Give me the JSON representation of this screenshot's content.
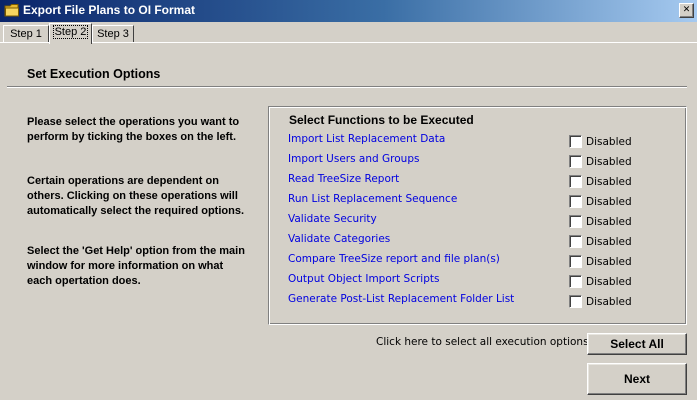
{
  "window": {
    "title": "Export File Plans to OI Format",
    "icon": "folder-icon",
    "close_glyph": "✕"
  },
  "tabs": [
    {
      "label": "Step 1",
      "active": false
    },
    {
      "label": "Step 2",
      "active": true
    },
    {
      "label": "Step 3",
      "active": false
    }
  ],
  "main": {
    "section_title": "Set Execution Options",
    "instructions": [
      "Please select the operations you want to perform by ticking the boxes on the left.",
      "Certain operations are dependent on others. Clicking on these operations will automatically select the required options.",
      "Select the 'Get Help' option from the main window for more information on what each opertation does."
    ],
    "group": {
      "title": "Select Functions to be Executed",
      "functions": [
        {
          "label": "Import List Replacement Data",
          "checked": false,
          "state": "Disabled"
        },
        {
          "label": "Import Users and Groups",
          "checked": false,
          "state": "Disabled"
        },
        {
          "label": "Read TreeSize Report",
          "checked": false,
          "state": "Disabled"
        },
        {
          "label": "Run List Replacement Sequence",
          "checked": false,
          "state": "Disabled"
        },
        {
          "label": "Validate Security",
          "checked": false,
          "state": "Disabled"
        },
        {
          "label": "Validate Categories",
          "checked": false,
          "state": "Disabled"
        },
        {
          "label": "Compare TreeSize report and file plan(s)",
          "checked": false,
          "state": "Disabled"
        },
        {
          "label": "Output Object Import Scripts",
          "checked": false,
          "state": "Disabled"
        },
        {
          "label": "Generate Post-List Replacement Folder List",
          "checked": false,
          "state": "Disabled"
        }
      ]
    },
    "select_all_hint": "Click here to select all execution options:",
    "select_all_label": "Select All",
    "next_label": "Next"
  },
  "colors": {
    "titlebar_start": "#0a246a",
    "titlebar_end": "#a6caf0",
    "link": "#0000e0",
    "face": "#d4d0c8"
  }
}
